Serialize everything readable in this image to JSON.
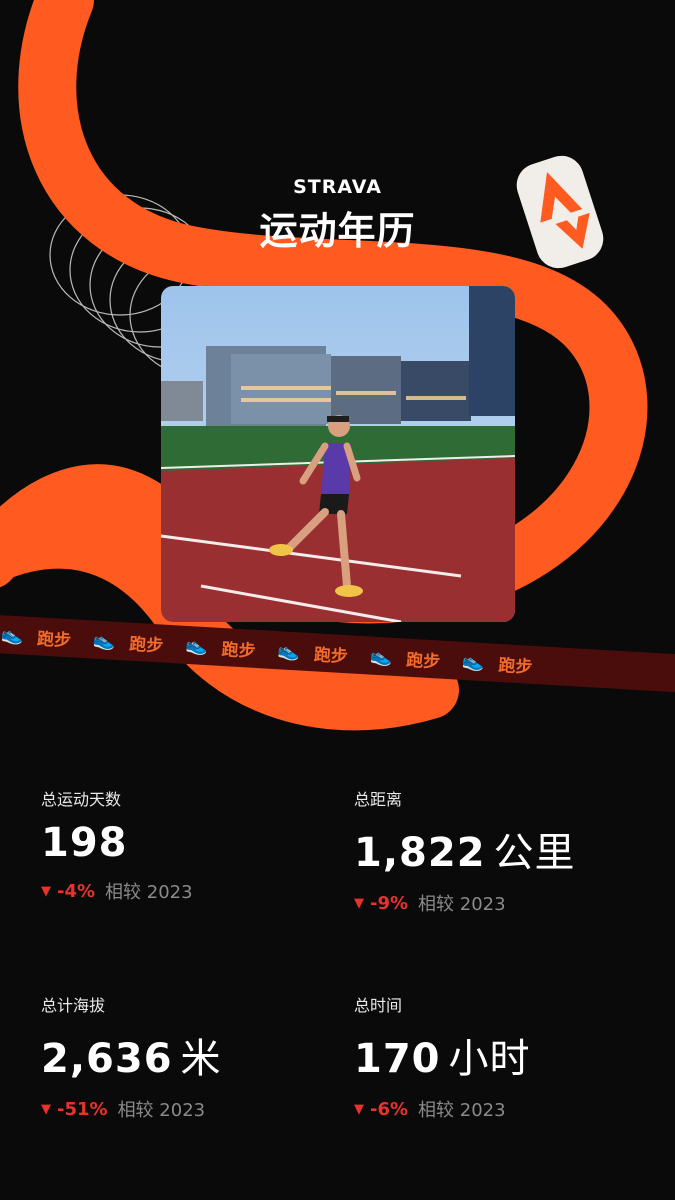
{
  "brand": {
    "logo": "STRAVA",
    "title": "运动年历"
  },
  "photo": {
    "subject": "runner on track"
  },
  "tape": {
    "label": "跑步",
    "repeat": 6
  },
  "colors": {
    "accent": "#ff5a1f",
    "background": "#0b0a0a",
    "down": "#e8322c",
    "muted": "#8a8a8a"
  },
  "stats": [
    {
      "label": "总运动天数",
      "value": "198",
      "unit": "",
      "change": "-4%",
      "compare": "相较 2023",
      "trend_icon": "down-triangle-icon"
    },
    {
      "label": "总距离",
      "value": "1,822",
      "unit": "公里",
      "change": "-9%",
      "compare": "相较 2023",
      "trend_icon": "down-triangle-icon"
    },
    {
      "label": "总计海拔",
      "value": "2,636",
      "unit": "米",
      "change": "-51%",
      "compare": "相较 2023",
      "trend_icon": "down-triangle-icon"
    },
    {
      "label": "总时间",
      "value": "170",
      "unit": "小时",
      "change": "-6%",
      "compare": "相较 2023",
      "trend_icon": "down-triangle-icon"
    }
  ]
}
